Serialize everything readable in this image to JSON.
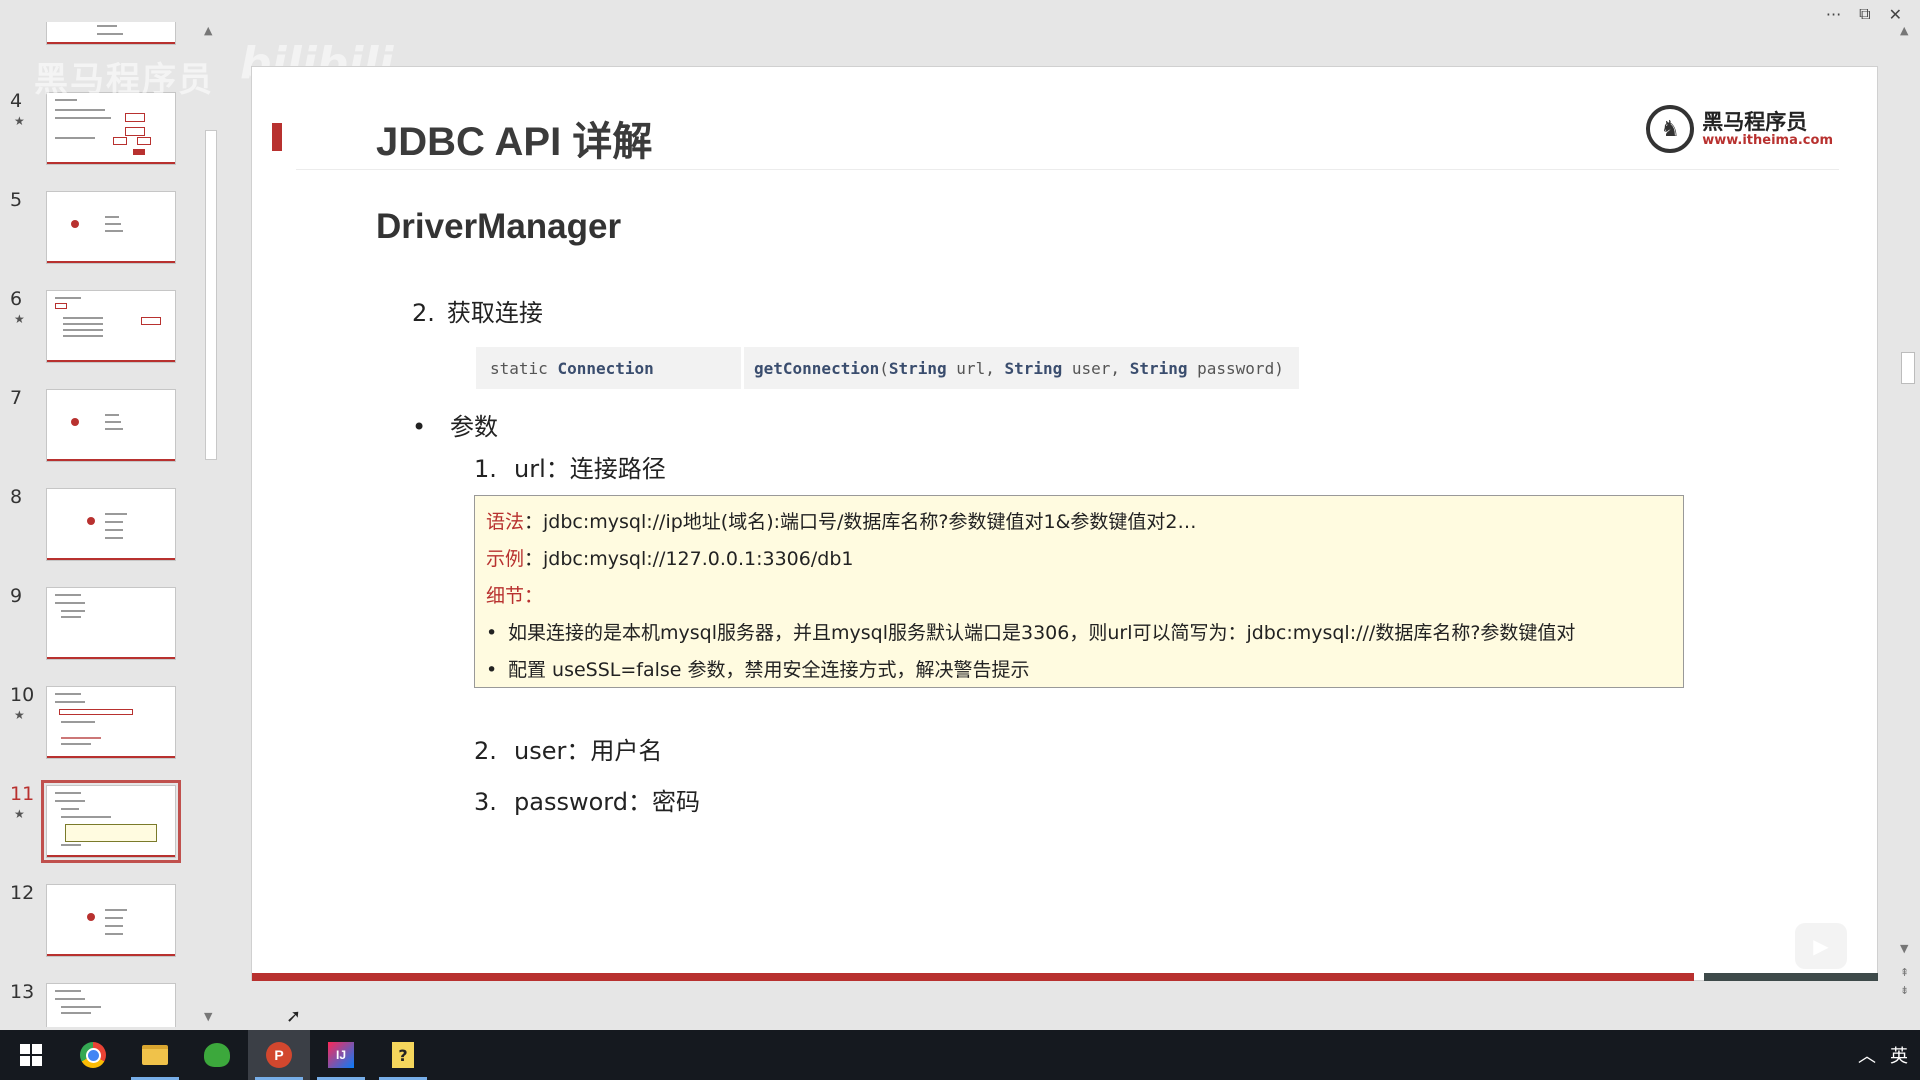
{
  "window": {
    "more_icon": "more-options-icon",
    "restore_icon": "restore-window-icon",
    "close_icon": "close-icon"
  },
  "watermark": {
    "text": "黑马程序员",
    "brand": "bilibili"
  },
  "thumbnails": [
    {
      "number": "4",
      "starred": true,
      "layout": "diagram"
    },
    {
      "number": "5",
      "starred": false,
      "layout": "list"
    },
    {
      "number": "6",
      "starred": true,
      "layout": "table"
    },
    {
      "number": "7",
      "starred": false,
      "layout": "list"
    },
    {
      "number": "8",
      "starred": false,
      "layout": "section"
    },
    {
      "number": "9",
      "starred": false,
      "layout": "text"
    },
    {
      "number": "10",
      "starred": true,
      "layout": "code"
    },
    {
      "number": "11",
      "starred": true,
      "layout": "current",
      "selected": true
    },
    {
      "number": "12",
      "starred": false,
      "layout": "section"
    },
    {
      "number": "13",
      "starred": false,
      "layout": "text"
    }
  ],
  "slide": {
    "title": "JDBC API 详解",
    "logo_name": "黑马程序员",
    "logo_url": "www.itheima.com",
    "section_heading": "DriverManager",
    "step": {
      "number": "2.",
      "text": "获取连接"
    },
    "signature": {
      "modifier": "static",
      "return_type": "Connection",
      "method": "getConnection",
      "open": "(",
      "p1_type": "String",
      "p1_name": " url, ",
      "p2_type": "String",
      "p2_name": " user, ",
      "p3_type": "String",
      "p3_name": " password)"
    },
    "params_label": "参数",
    "param_items": [
      {
        "number": "1.",
        "text": "url：连接路径"
      },
      {
        "number": "2.",
        "text": "user：用户名"
      },
      {
        "number": "3.",
        "text": "password：密码"
      }
    ],
    "url_box": {
      "syntax_label": "语法",
      "syntax_text": "：jdbc:mysql://ip地址(域名):端口号/数据库名称?参数键值对1&参数键值对2…",
      "example_label": "示例",
      "example_text": "：jdbc:mysql://127.0.0.1:3306/db1",
      "detail_label": "细节",
      "detail_colon": "：",
      "bullets": [
        "如果连接的是本机mysql服务器，并且mysql服务默认端口是3306，则url可以简写为：jdbc:mysql:///数据库名称?参数键值对",
        "配置 useSSL=false 参数，禁用安全连接方式，解决警告提示"
      ]
    }
  },
  "taskbar": {
    "items": [
      "windows-start",
      "chrome",
      "file-explorer",
      "sourcetree",
      "powerpoint",
      "intellij-idea",
      "notes"
    ],
    "active": "powerpoint",
    "ime": "英"
  },
  "colors": {
    "accent": "#b8312f",
    "box_bg": "#fffbe0",
    "code_bg": "#f2f2f2"
  }
}
